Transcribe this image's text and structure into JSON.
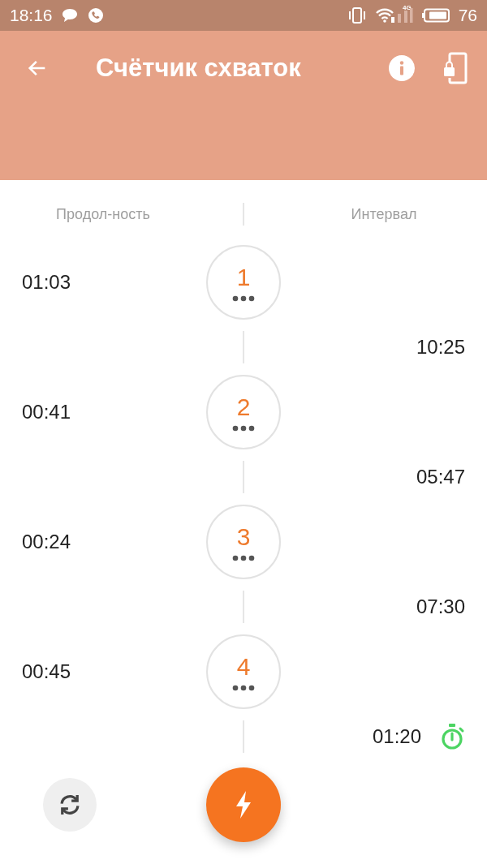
{
  "status_bar": {
    "time": "18:16",
    "network_label": "4G",
    "battery": "76"
  },
  "app_bar": {
    "title": "Счётчик схваток"
  },
  "columns": {
    "left": "Продол-ность",
    "right": "Интервал"
  },
  "contractions": [
    {
      "number": "1",
      "duration": "01:03",
      "interval": "10:25",
      "running": false
    },
    {
      "number": "2",
      "duration": "00:41",
      "interval": "05:47",
      "running": false
    },
    {
      "number": "3",
      "duration": "00:24",
      "interval": "07:30",
      "running": false
    },
    {
      "number": "4",
      "duration": "00:45",
      "interval": "01:20",
      "running": true
    }
  ]
}
